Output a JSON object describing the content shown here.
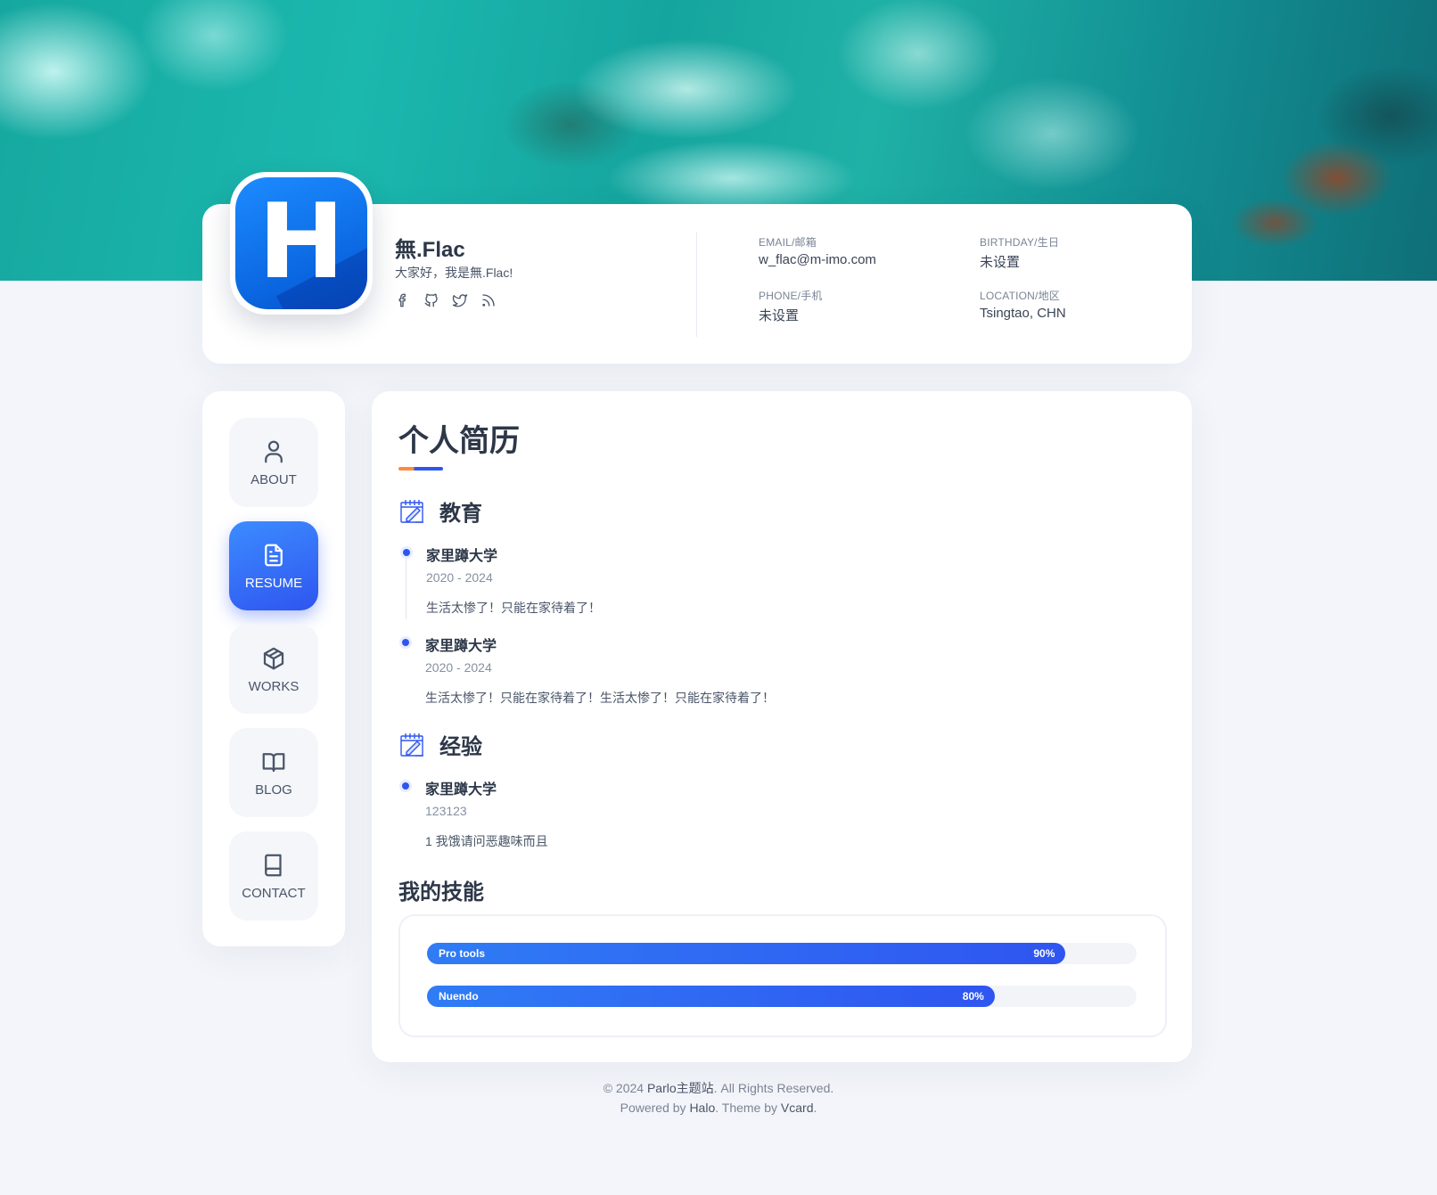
{
  "profile": {
    "name": "無.Flac",
    "bio": "大家好，我是無.Flac!",
    "avatar_letter": "H",
    "socials": [
      "facebook-icon",
      "github-icon",
      "twitter-icon",
      "rss-icon"
    ],
    "email_label": "EMAIL/邮箱",
    "email_value": "w_flac@m-imo.com",
    "birthday_label": "BIRTHDAY/生日",
    "birthday_value": "未设置",
    "phone_label": "PHONE/手机",
    "phone_value": "未设置",
    "location_label": "LOCATION/地区",
    "location_value": "Tsingtao, CHN"
  },
  "nav": {
    "items": [
      {
        "label": "ABOUT",
        "icon": "user-icon"
      },
      {
        "label": "RESUME",
        "icon": "document-icon",
        "active": true
      },
      {
        "label": "WORKS",
        "icon": "cube-icon"
      },
      {
        "label": "BLOG",
        "icon": "book-open-icon"
      },
      {
        "label": "CONTACT",
        "icon": "book-icon"
      }
    ]
  },
  "resume": {
    "title": "个人简历",
    "education": {
      "heading": "教育",
      "items": [
        {
          "title": "家里蹲大学",
          "date": "2020 - 2024",
          "desc": "生活太惨了！只能在家待着了！"
        },
        {
          "title": "家里蹲大学",
          "date": "2020 - 2024",
          "desc": "生活太惨了！只能在家待着了！生活太惨了！只能在家待着了！"
        }
      ]
    },
    "experience": {
      "heading": "经验",
      "items": [
        {
          "title": "家里蹲大学",
          "date": "123123",
          "desc": "1 我饿请问恶趣味而且"
        }
      ]
    },
    "skills": {
      "heading": "我的技能",
      "items": [
        {
          "name": "Pro tools",
          "percent_label": "90%",
          "percent": 0.9
        },
        {
          "name": "Nuendo",
          "percent_label": "80%",
          "percent": 0.8
        }
      ]
    }
  },
  "footer": {
    "line1_prefix": "© 2024 ",
    "line1_link": "Parlo主题站",
    "line1_suffix": ". All Rights Reserved.",
    "line2_prefix": "Powered by ",
    "line2_link1": "Halo",
    "line2_mid": ". Theme by ",
    "line2_link2": "Vcard",
    "line2_suffix": "."
  },
  "colors": {
    "accent": "#2f55f0",
    "accent_light": "#3c8cff",
    "title_underline_orange": "#ff8a3c"
  }
}
